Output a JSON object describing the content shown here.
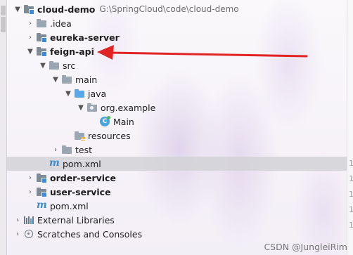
{
  "tree": {
    "root": {
      "label": "cloud-demo",
      "path": "G:\\SpringCloud\\code\\cloud-demo"
    },
    "items": [
      {
        "label": ".idea"
      },
      {
        "label": "eureka-server"
      },
      {
        "label": "feign-api"
      },
      {
        "label": "src"
      },
      {
        "label": "main"
      },
      {
        "label": "java"
      },
      {
        "label": "org.example"
      },
      {
        "label": "Main"
      },
      {
        "label": "resources"
      },
      {
        "label": "test"
      },
      {
        "label": "pom.xml"
      },
      {
        "label": "order-service"
      },
      {
        "label": "user-service"
      },
      {
        "label": "pom.xml"
      },
      {
        "label": "External Libraries"
      },
      {
        "label": "Scratches and Consoles"
      }
    ],
    "selected_index": 10
  },
  "class_icon_letter": "C",
  "pom_icon_letter": "m",
  "gutter_numbers": [
    "1",
    "1",
    "1",
    "1",
    "1"
  ],
  "watermark": "CSDN @JungleiRim",
  "colors": {
    "arrow": "#e02424",
    "selection": "#d2d2d6",
    "folder": "#9aa6b2",
    "source_folder": "#5aa6e6",
    "module_marker": "#3d8ad6"
  }
}
